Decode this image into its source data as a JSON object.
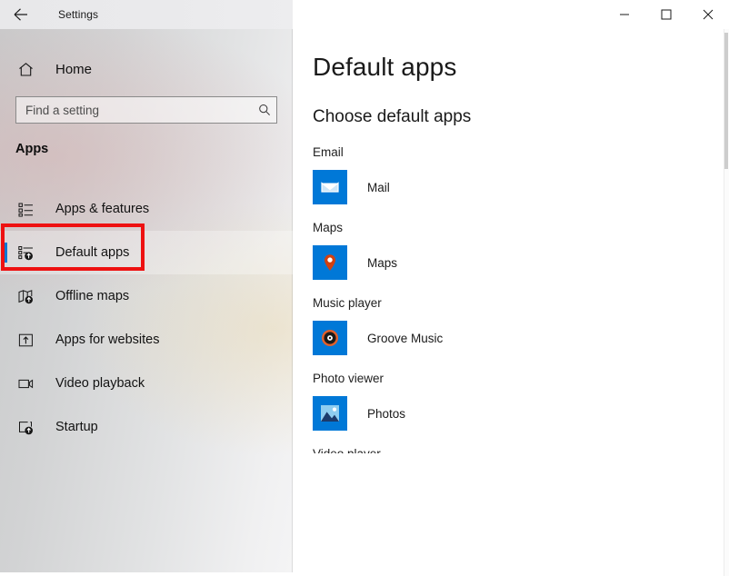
{
  "window": {
    "title": "Settings",
    "back_icon": "back-arrow-icon",
    "controls": {
      "minimize": "minimize-icon",
      "maximize": "maximize-icon",
      "close": "close-icon"
    }
  },
  "sidebar": {
    "home": {
      "label": "Home",
      "icon": "home-icon"
    },
    "search": {
      "placeholder": "Find a setting",
      "value": "",
      "icon": "search-icon"
    },
    "section_title": "Apps",
    "items": [
      {
        "label": "Apps & features",
        "icon": "list-features-icon",
        "selected": false
      },
      {
        "label": "Default apps",
        "icon": "default-apps-icon",
        "selected": true
      },
      {
        "label": "Offline maps",
        "icon": "offline-maps-icon",
        "selected": false
      },
      {
        "label": "Apps for websites",
        "icon": "apps-for-websites-icon",
        "selected": false
      },
      {
        "label": "Video playback",
        "icon": "video-playback-icon",
        "selected": false
      },
      {
        "label": "Startup",
        "icon": "startup-icon",
        "selected": false
      }
    ],
    "selected_accent_color": "#0078d4",
    "highlight_color": "#ee1111"
  },
  "main": {
    "page_title": "Default apps",
    "section_heading": "Choose default apps",
    "sections": [
      {
        "category": "Email",
        "app_name": "Mail",
        "icon": "mail-envelope-icon",
        "tile_color": "#0078d7"
      },
      {
        "category": "Maps",
        "app_name": "Maps",
        "icon": "map-pin-icon",
        "tile_color": "#0078d7"
      },
      {
        "category": "Music player",
        "app_name": "Groove Music",
        "icon": "groove-music-disc-icon",
        "tile_color": "#0078d7"
      },
      {
        "category": "Photo viewer",
        "app_name": "Photos",
        "icon": "photos-mountain-icon",
        "tile_color": "#0078d7"
      }
    ],
    "clipped_next_category": "Video player"
  },
  "scrollbar": {
    "name": "vertical-scrollbar"
  }
}
